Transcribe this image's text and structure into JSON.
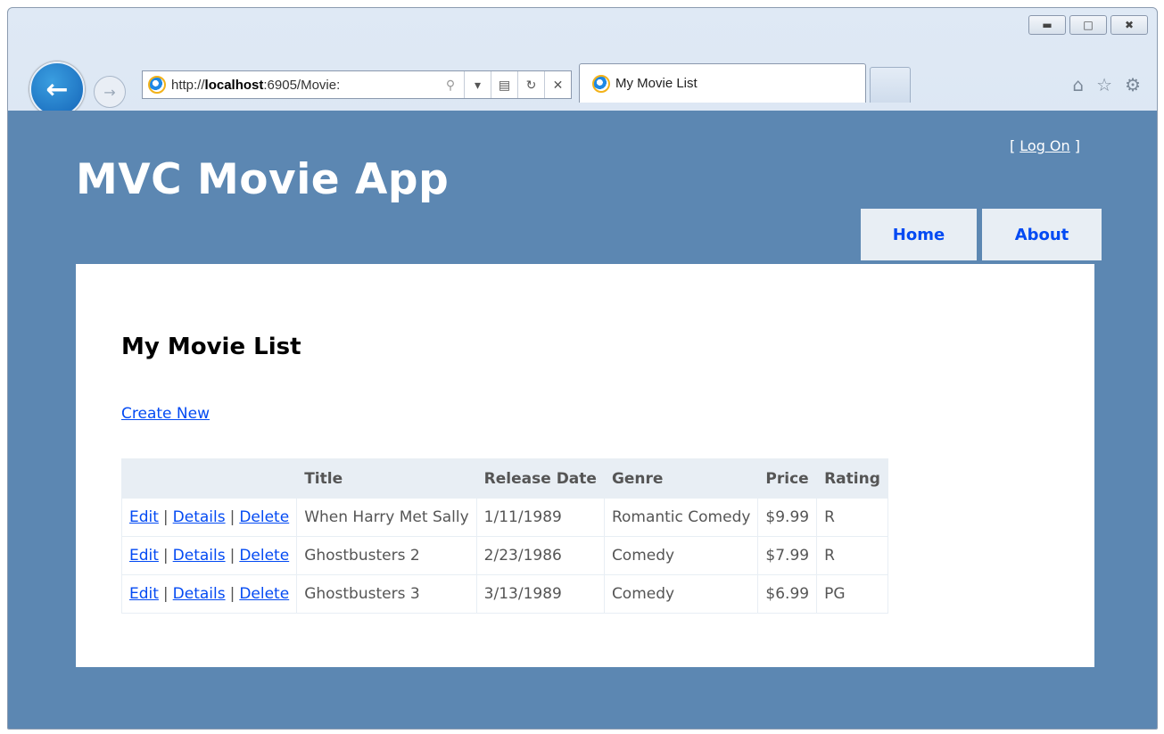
{
  "browser": {
    "url_prefix": "http://",
    "url_host": "localhost",
    "url_rest": ":6905/Movie:",
    "tab_title": "My Movie List",
    "window_controls": [
      "minimize-icon",
      "restore-icon",
      "close-icon"
    ],
    "toolbar_icons": [
      "home-icon",
      "favorites-star-icon",
      "gear-icon"
    ]
  },
  "header": {
    "logon_open": "[ ",
    "logon_label": "Log On",
    "logon_close": " ]",
    "app_title": "MVC Movie App",
    "menu": [
      {
        "label": "Home"
      },
      {
        "label": "About"
      }
    ]
  },
  "main": {
    "heading": "My Movie List",
    "create_new": "Create New",
    "columns": [
      "",
      "Title",
      "Release Date",
      "Genre",
      "Price",
      "Rating"
    ],
    "action_labels": {
      "edit": "Edit",
      "details": "Details",
      "delete": "Delete",
      "separator": "|"
    },
    "rows": [
      {
        "title": "When Harry Met Sally",
        "release_date": "1/11/1989",
        "genre": "Romantic Comedy",
        "price": "$9.99",
        "rating": "R"
      },
      {
        "title": "Ghostbusters 2",
        "release_date": "2/23/1986",
        "genre": "Comedy",
        "price": "$7.99",
        "rating": "R"
      },
      {
        "title": "Ghostbusters 3",
        "release_date": "3/13/1989",
        "genre": "Comedy",
        "price": "$6.99",
        "rating": "PG"
      }
    ]
  },
  "colors": {
    "page_background": "#5c87b2",
    "link": "#034af3",
    "menu_background": "#e8eef4"
  }
}
